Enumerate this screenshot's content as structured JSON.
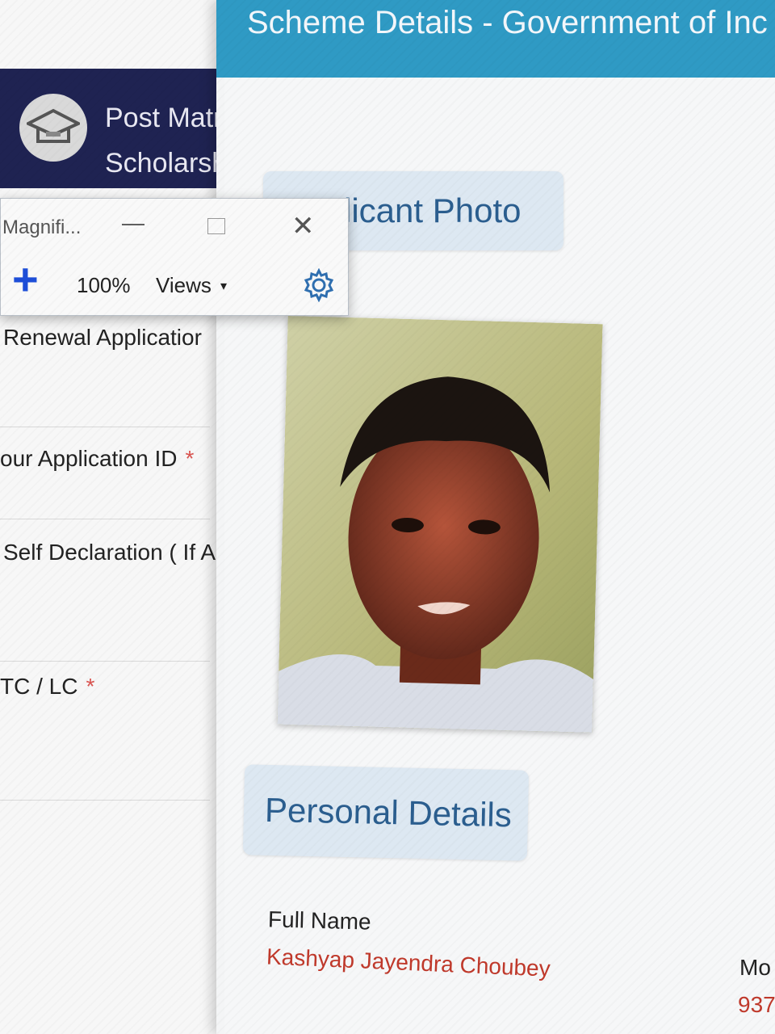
{
  "left_window": {
    "portal_title_line1": "Post Matr",
    "portal_title_line2": "Scholarsh",
    "form_labels": {
      "renewal": "Renewal Applicatior",
      "application_id": "our Application ID",
      "self_declaration": "Self Declaration ( If A",
      "tc_lc": "TC / LC"
    },
    "required_mark": "*"
  },
  "main_window": {
    "title": "Scheme Details - Government of Inc",
    "applicant_photo_heading": "licant Photo",
    "personal_details_heading": "Personal Details",
    "full_name_label": "Full Name",
    "full_name_value": "Kashyap Jayendra Choubey",
    "mobile_label_partial": "Mo",
    "mobile_value_partial": "937"
  },
  "magnifier": {
    "title": "Magnifi...",
    "minimize": "—",
    "close": "✕",
    "zoom_in": "+",
    "zoom_level": "100%",
    "views_label": "Views",
    "views_caret": "▾"
  },
  "colors": {
    "portal_header": "#1f2352",
    "main_topbar": "#2f9ac4",
    "section_heading_bg": "#dde8f2",
    "section_heading_text": "#2b5e8f",
    "value_text": "#c0392b",
    "required": "#d9534f"
  }
}
